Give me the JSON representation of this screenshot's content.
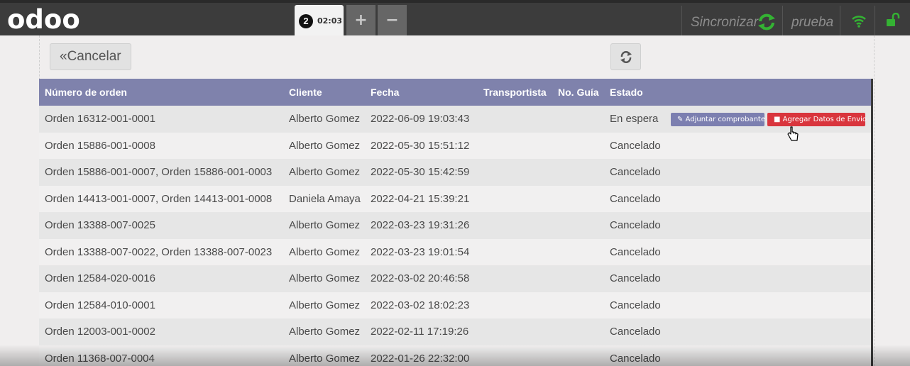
{
  "topbar": {
    "logo": "odoo",
    "order_tab": {
      "number": "2",
      "time": "02:03"
    },
    "add_label": "+",
    "remove_label": "−",
    "sync_label": "Sincronizar",
    "user": "prueba",
    "icons": [
      "sync-icon",
      "wifi-icon",
      "unlock-icon"
    ],
    "accent_color": "#34b233"
  },
  "actions": {
    "cancel_label": "«Cancelar",
    "refresh_icon": "refresh-icon"
  },
  "table": {
    "header_color": "#7f82ac",
    "headers": [
      "Número de orden",
      "Cliente",
      "Fecha",
      "Transportista",
      "No. Guía",
      "Estado"
    ],
    "rows": [
      {
        "orden": "Orden 16312-001-0001",
        "cliente": "Alberto Gomez",
        "fecha": "2022-06-09 19:03:43",
        "transportista": "",
        "guia": "",
        "estado": "En espera",
        "attach_label": "Adjuntar comprobante",
        "ship_label": "Agregar Datos de Envio"
      },
      {
        "orden": "Orden 15886-001-0008",
        "cliente": "Alberto Gomez",
        "fecha": "2022-05-30 15:51:12",
        "transportista": "",
        "guia": "",
        "estado": "Cancelado"
      },
      {
        "orden": "Orden 15886-001-0007, Orden 15886-001-0003",
        "cliente": "Alberto Gomez",
        "fecha": "2022-05-30 15:42:59",
        "transportista": "",
        "guia": "",
        "estado": "Cancelado"
      },
      {
        "orden": "Orden 14413-001-0007, Orden 14413-001-0008",
        "cliente": "Daniela Amaya",
        "fecha": "2022-04-21 15:39:21",
        "transportista": "",
        "guia": "",
        "estado": "Cancelado"
      },
      {
        "orden": "Orden 13388-007-0025",
        "cliente": "Alberto Gomez",
        "fecha": "2022-03-23 19:31:26",
        "transportista": "",
        "guia": "",
        "estado": "Cancelado"
      },
      {
        "orden": "Orden 13388-007-0022, Orden 13388-007-0023",
        "cliente": "Alberto Gomez",
        "fecha": "2022-03-23 19:01:54",
        "transportista": "",
        "guia": "",
        "estado": "Cancelado"
      },
      {
        "orden": "Orden 12584-020-0016",
        "cliente": "Alberto Gomez",
        "fecha": "2022-03-02 20:46:58",
        "transportista": "",
        "guia": "",
        "estado": "Cancelado"
      },
      {
        "orden": "Orden 12584-010-0001",
        "cliente": "Alberto Gomez",
        "fecha": "2022-03-02 18:02:23",
        "transportista": "",
        "guia": "",
        "estado": "Cancelado"
      },
      {
        "orden": "Orden 12003-001-0002",
        "cliente": "Alberto Gomez",
        "fecha": "2022-02-11 17:19:26",
        "transportista": "",
        "guia": "",
        "estado": "Cancelado"
      },
      {
        "orden": "Orden 11368-007-0004",
        "cliente": "Alberto Gomez",
        "fecha": "2022-01-26 22:32:00",
        "transportista": "",
        "guia": "",
        "estado": "Cancelado"
      }
    ]
  }
}
